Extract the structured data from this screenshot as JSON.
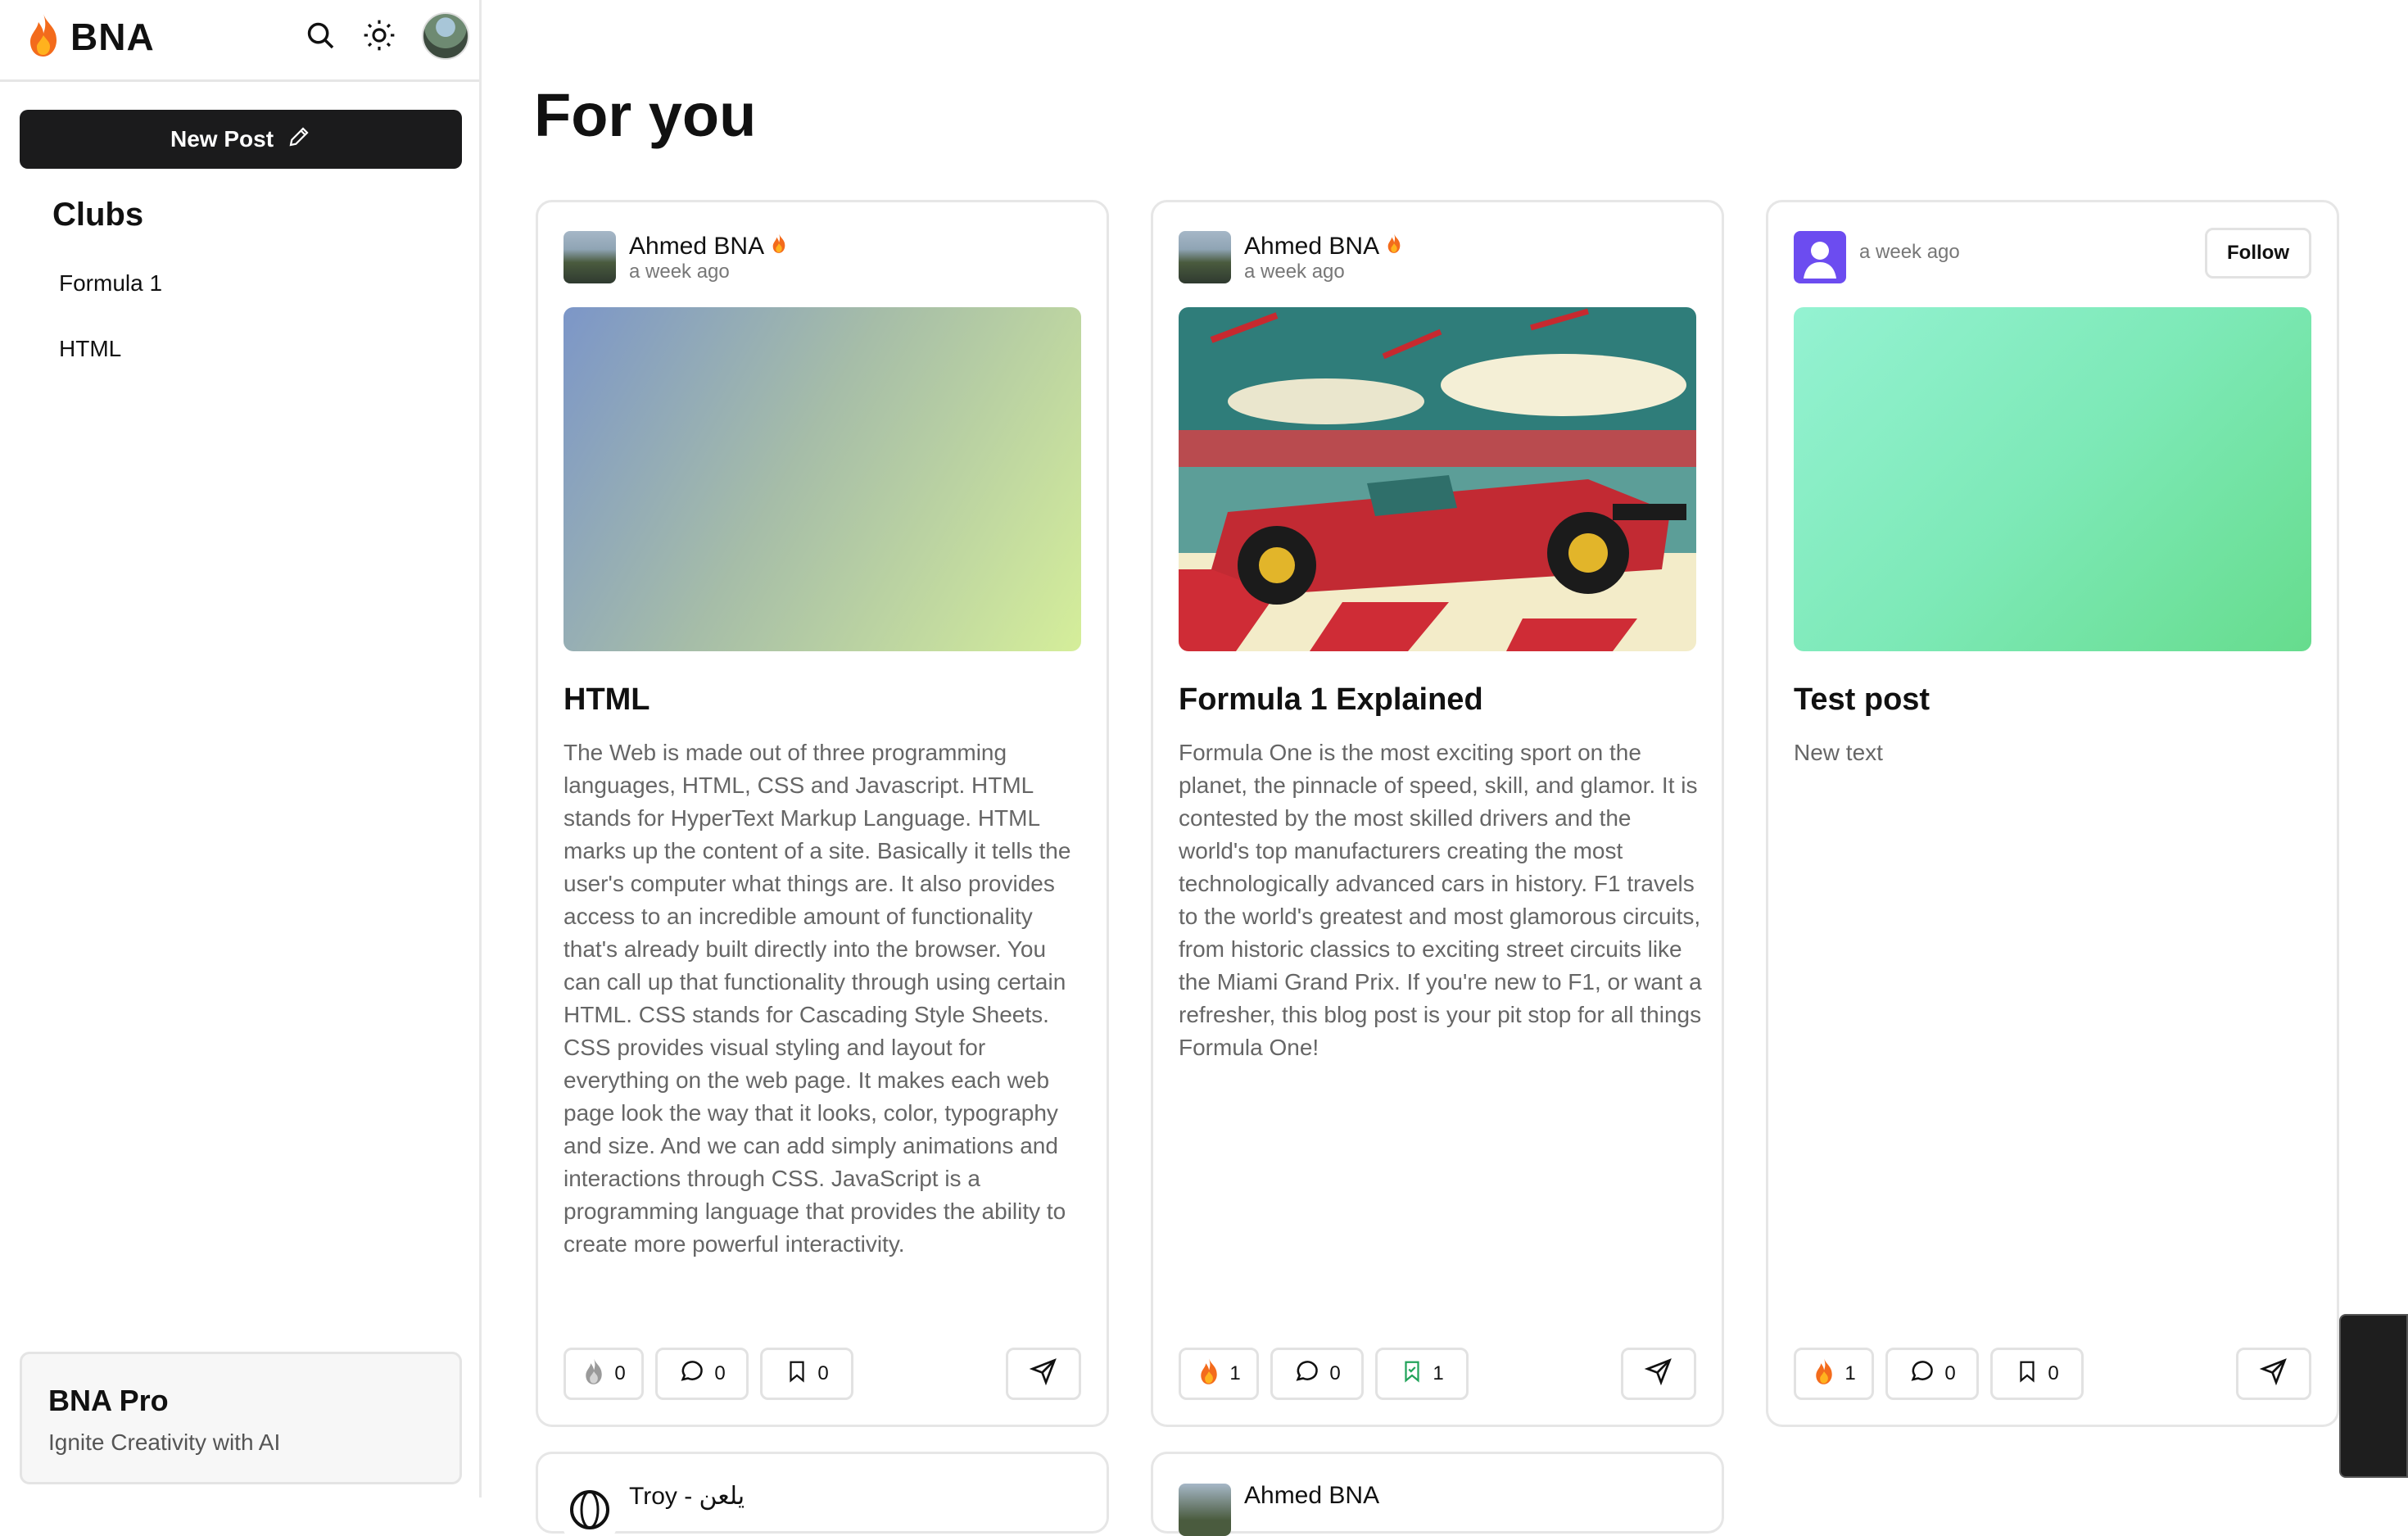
{
  "app": {
    "name": "BNA"
  },
  "sidebar": {
    "new_post_label": "New Post",
    "clubs_title": "Clubs",
    "clubs": [
      "Formula 1",
      "HTML"
    ],
    "pro": {
      "title": "BNA Pro",
      "subtitle": "Ignite Creativity with AI"
    }
  },
  "main": {
    "title": "For you",
    "posts": [
      {
        "author": "Ahmed BNA",
        "time": "a week ago",
        "title": "HTML",
        "body": "The Web is made out of three programming languages, HTML, CSS and Javascript. HTML stands for HyperText Markup Language. HTML marks up the content of a site. Basically it tells the user's computer what things are. It also provides access to an incredible amount of functionality that's already built directly into the browser. You can call up that functionality through using certain HTML. CSS stands for Cascading Style Sheets. CSS provides visual styling and layout for everything on the web page. It makes each web page look the way that it looks, color, typography and size. And we can add simply animations and interactions through CSS. JavaScript is a programming language that provides the ability to create more powerful interactivity.",
        "likes": "0",
        "comments": "0",
        "saves": "0"
      },
      {
        "author": "Ahmed BNA",
        "time": "a week ago",
        "title": "Formula 1 Explained",
        "body": "Formula One is the most exciting sport on the planet, the pinnacle of speed, skill, and glamor. It is contested by the most skilled drivers and the world's top manufacturers creating the most technologically advanced cars in history. F1 travels to the world's greatest and most glamorous circuits, from historic classics to exciting street circuits like the Miami Grand Prix. If you're new to F1, or want a refresher, this blog post is your pit stop for all things Formula One!",
        "likes": "1",
        "comments": "0",
        "saves": "1"
      },
      {
        "author": "",
        "time": "a week ago",
        "follow_label": "Follow",
        "title": "Test post",
        "body": "New text",
        "likes": "1",
        "comments": "0",
        "saves": "0"
      }
    ],
    "next_posts": [
      {
        "author": "Troy - يلعن"
      },
      {
        "author": "Ahmed BNA"
      }
    ]
  },
  "colors": {
    "accent_dark": "#1b1b1c",
    "flame": "#f36b1c",
    "saved_green": "#22a35a",
    "user_avatar": "#6c4cf0"
  },
  "icons": [
    "flame-icon",
    "search-icon",
    "sun-icon",
    "pencil-icon",
    "comment-icon",
    "bookmark-icon",
    "bookmark-check-icon",
    "send-icon"
  ]
}
